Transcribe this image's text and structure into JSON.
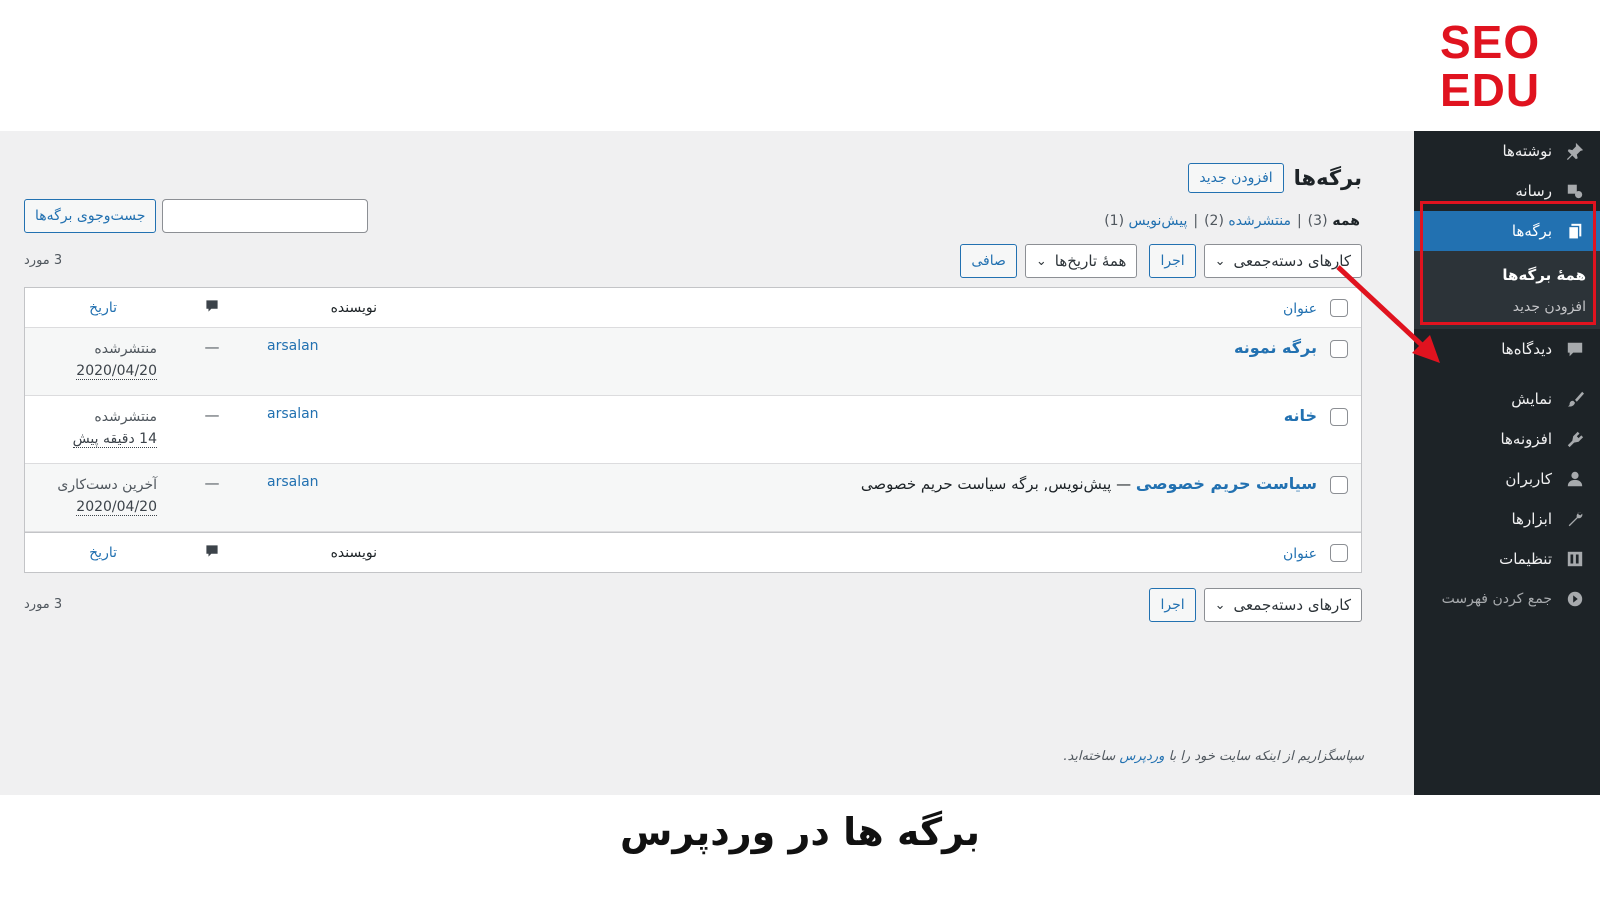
{
  "logo": {
    "line1": "SEO",
    "line2": "EDU"
  },
  "sidebar": {
    "items": [
      {
        "label": "نوشته‌ها",
        "icon": "pin-icon"
      },
      {
        "label": "رسانه",
        "icon": "media-icon"
      },
      {
        "label": "برگه‌ها",
        "icon": "pages-icon",
        "active": true
      },
      {
        "label": "دیدگاه‌ها",
        "icon": "comment-icon"
      },
      {
        "label": "نمایش",
        "icon": "brush-icon"
      },
      {
        "label": "افزونه‌ها",
        "icon": "plugin-icon"
      },
      {
        "label": "کاربران",
        "icon": "user-icon"
      },
      {
        "label": "ابزارها",
        "icon": "wrench-icon"
      },
      {
        "label": "تنظیمات",
        "icon": "settings-icon"
      },
      {
        "label": "جمع کردن فهرست",
        "icon": "collapse-icon"
      }
    ],
    "submenu": {
      "all_pages": "همهٔ برگه‌ها",
      "add_new": "افزودن جدید"
    }
  },
  "header": {
    "title": "برگه‌ها",
    "add_new": "افزودن جدید"
  },
  "filters": {
    "all": "همه",
    "all_count": "(3)",
    "published": "منتشرشده",
    "published_count": "(2)",
    "draft": "پیش‌نویس",
    "draft_count": "(1)",
    "sep": "|"
  },
  "search": {
    "button": "جست‌وجوی برگه‌ها",
    "value": ""
  },
  "tablenav": {
    "bulk_actions": "کارهای دسته‌جمعی",
    "apply": "اجرا",
    "all_dates": "همهٔ تاریخ‌ها",
    "filter": "صافی",
    "count": "3 مورد"
  },
  "table": {
    "columns": {
      "title": "عنوان",
      "author": "نویسنده",
      "date": "تاریخ"
    },
    "rows": [
      {
        "title": "برگه نمونه",
        "state": "",
        "author": "arsalan",
        "comments": "—",
        "date_status": "منتشرشده",
        "date": "2020/04/20"
      },
      {
        "title": "خانه",
        "state": "",
        "author": "arsalan",
        "comments": "—",
        "date_status": "منتشرشده",
        "date": "14 دقیقه پیش"
      },
      {
        "title": "سیاست حریم خصوصی",
        "state": "— پیش‌نویس, برگه سیاست حریم خصوصی",
        "author": "arsalan",
        "comments": "—",
        "date_status": "آخرین دست‌کاری",
        "date": "2020/04/20"
      }
    ]
  },
  "footer": {
    "before": "سپاسگزاریم از اینکه سایت خود را با ",
    "link": "وردپرس",
    "after": " ساخته‌اید."
  },
  "caption": "برگه ها در وردپرس",
  "colors": {
    "accent": "#2271b1",
    "sidebar": "#1d2327",
    "highlight": "#e0131f"
  }
}
